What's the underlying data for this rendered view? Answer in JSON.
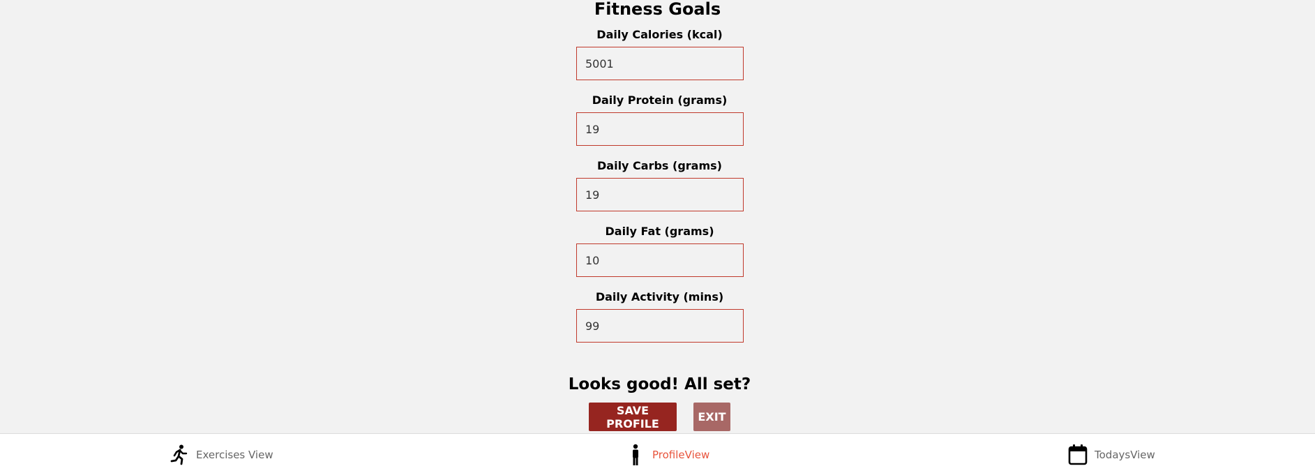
{
  "page": {
    "title": "Fitness Goals"
  },
  "fields": [
    {
      "label": "Daily Calories (kcal)",
      "value": "5001"
    },
    {
      "label": "Daily Protein (grams)",
      "value": "19"
    },
    {
      "label": "Daily Carbs (grams)",
      "value": "19"
    },
    {
      "label": "Daily Fat (grams)",
      "value": "10"
    },
    {
      "label": "Daily Activity (mins)",
      "value": "99"
    }
  ],
  "confirm": {
    "text": "Looks good! All set?",
    "save_label": "SAVE PROFILE",
    "exit_label": "EXIT"
  },
  "nav": {
    "items": [
      {
        "label": "Exercises View",
        "icon": "running-person-icon",
        "active": false
      },
      {
        "label": "ProfileView",
        "icon": "person-icon",
        "active": true
      },
      {
        "label": "TodaysView",
        "icon": "calendar-icon",
        "active": false
      }
    ],
    "active_color": "#e8543c"
  },
  "colors": {
    "background": "#f2f2f2",
    "input_border": "#c0392b",
    "save_button": "#962520",
    "exit_button": "#a86866"
  }
}
